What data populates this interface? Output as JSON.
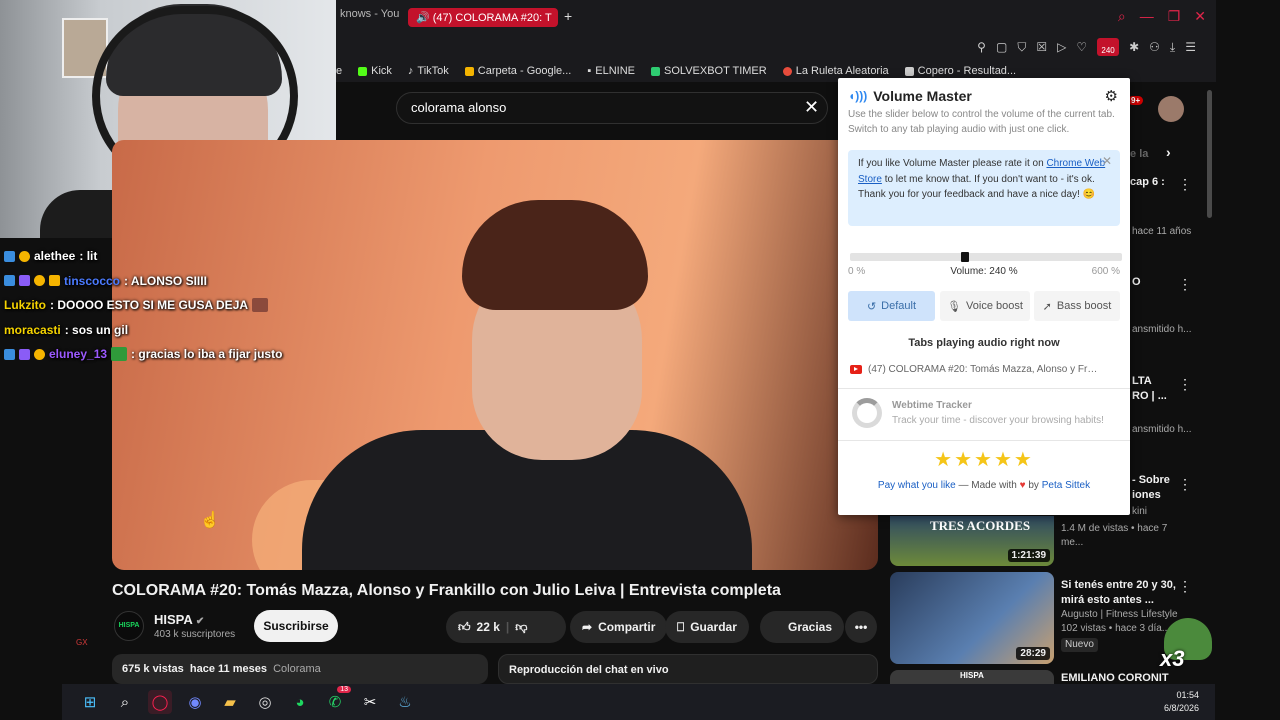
{
  "browser": {
    "prev_tab_title": "knows - You",
    "active_tab_title": "(47) COLORAMA #20: T",
    "new_tab": "+",
    "volume_badge": "240",
    "bookmarks": [
      {
        "label": "e",
        "color": ""
      },
      {
        "label": "Kick",
        "color": "#53fc18"
      },
      {
        "label": "TikTok",
        "color": "#ffffff"
      },
      {
        "label": "Carpeta - Google...",
        "color": "#f4b400"
      },
      {
        "label": "ELNINE",
        "color": "#ffffff"
      },
      {
        "label": "SOLVEXBOT TIMER",
        "color": "#2ecc71"
      },
      {
        "label": "La Ruleta Aleatoria",
        "color": "#e74c3c"
      },
      {
        "label": "Copero - Resultad...",
        "color": "#cccccc"
      }
    ]
  },
  "youtube": {
    "search_value": "colorama alonso",
    "video_title": "COLORAMA #20: Tomás Mazza, Alonso y Frankillo con Julio Leiva | Entrevista completa",
    "channel": {
      "name": "HISPA",
      "avatar_text": "HISPA",
      "subscribers": "403 k suscriptores",
      "subscribe_label": "Suscribirse"
    },
    "actions": {
      "likes": "22 k",
      "share": "Compartir",
      "save": "Guardar",
      "thanks": "Gracias"
    },
    "description": {
      "views": "675 k vistas",
      "date": "hace 11 meses",
      "tag": "Colorama"
    },
    "chat_replay": "Reproducción del chat en vivo"
  },
  "chat": [
    {
      "user": "alethee",
      "color": "#ffffff",
      "message": ": lit"
    },
    {
      "user": "tinscocco",
      "color": "#4b7bff",
      "message": ": ALONSO SIIII"
    },
    {
      "user": "Lukzito",
      "color": "#f5d300",
      "message": ": DOOOO ESTO SI ME GUSA DEJA"
    },
    {
      "user": "moracasti",
      "color": "#f5d300",
      "message": ": sos un gil"
    },
    {
      "user": "eluney_13",
      "color": "#9b59ff",
      "message": ":  gracias lo iba a fijar justo"
    }
  ],
  "recommendations": [
    {
      "title": "",
      "fragments": [
        "le la",
        "cap 6 :",
        "hace 11 años"
      ]
    },
    {
      "title": "",
      "fragments": [
        "O",
        "ansmitido h..."
      ]
    },
    {
      "title": "",
      "fragments": [
        "LTA",
        "RO | ...",
        "ansmitido h..."
      ]
    },
    {
      "title": "",
      "fragments": [
        "- Sobre",
        "iones",
        "kini"
      ]
    },
    {
      "title": "",
      "thumb_text": "TRES ACORDES",
      "duration": "1:21:39",
      "meta": "1.4 M de vistas • hace 7 me..."
    },
    {
      "title": "Si tenés entre 20 y 30, mirá esto antes ...",
      "duration": "28:29",
      "channel": "Augusto | Fitness Lifestyle",
      "meta": "102 vistas • hace 3 día...",
      "badge": "Nuevo"
    },
    {
      "title": "EMILIANO CORONIT",
      "thumb_text": "HISPA"
    }
  ],
  "volume_master": {
    "title": "Volume Master",
    "description": "Use the slider below to control the volume of the current tab. Switch to any tab playing audio with just one click.",
    "rate_before": "If you like Volume Master please rate it on",
    "rate_link": "Chrome Web Store",
    "rate_after": "to let me know that. If you don't want to - it's ok. Thank you for your feedback and have a nice day! 😊",
    "volume_level": 240,
    "volume_max": 600,
    "scale_min": "0 %",
    "scale_max": "600 %",
    "volume_label": "Volume: 240 %",
    "buttons": {
      "default": "Default",
      "voice": "Voice boost",
      "bass": "Bass boost"
    },
    "tabs_title": "Tabs playing audio right now",
    "tab_item": "(47) COLORAMA #20: Tomás Mazza, Alonso y Fr…",
    "webtime_title": "Webtime Tracker",
    "webtime_desc": "Track your time - discover your browsing habits!",
    "stars": "★★★★★",
    "footer_link": "Pay what you like",
    "footer_mid": "— Made with",
    "footer_by": "by",
    "footer_author": "Peta Sittek"
  },
  "taskbar": {
    "time": "01:54",
    "date": "6/8/2026",
    "whatsapp_badge": "13"
  },
  "overlay": {
    "multiplier": "x3",
    "gx_label": "GX"
  }
}
